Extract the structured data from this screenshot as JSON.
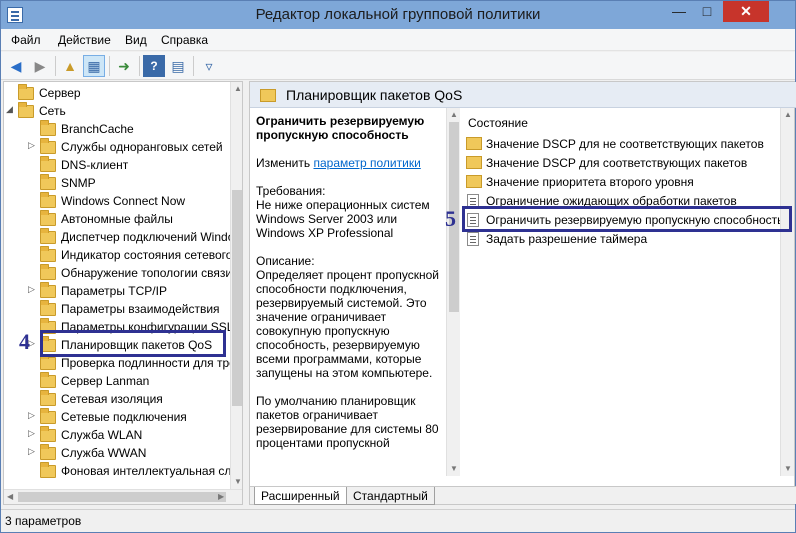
{
  "window": {
    "title": "Редактор локальной групповой политики"
  },
  "menu": [
    "Файл",
    "Действие",
    "Вид",
    "Справка"
  ],
  "tree": {
    "items": [
      {
        "label": "Сервер",
        "expander": ""
      },
      {
        "label": "Сеть",
        "expander": "◢"
      },
      {
        "label": "BranchCache",
        "expander": ""
      },
      {
        "label": "Службы одноранговых сетей",
        "expander": "▷"
      },
      {
        "label": "DNS-клиент",
        "expander": ""
      },
      {
        "label": "SNMP",
        "expander": ""
      },
      {
        "label": "Windows Connect Now",
        "expander": ""
      },
      {
        "label": "Автономные файлы",
        "expander": ""
      },
      {
        "label": "Диспетчер подключений Windows",
        "expander": ""
      },
      {
        "label": "Индикатор состояния сетевого подключения",
        "expander": ""
      },
      {
        "label": "Обнаружение топологии связи",
        "expander": ""
      },
      {
        "label": "Параметры TCP/IP",
        "expander": "▷"
      },
      {
        "label": "Параметры взаимодействия",
        "expander": ""
      },
      {
        "label": "Параметры конфигурации SSL",
        "expander": ""
      },
      {
        "label": "Планировщик пакетов QoS",
        "expander": "▷"
      },
      {
        "label": "Проверка подлинности для требования",
        "expander": ""
      },
      {
        "label": "Сервер Lanman",
        "expander": ""
      },
      {
        "label": "Сетевая изоляция",
        "expander": ""
      },
      {
        "label": "Сетевые подключения",
        "expander": "▷"
      },
      {
        "label": "Служба WLAN",
        "expander": "▷"
      },
      {
        "label": "Служба WWAN",
        "expander": "▷"
      },
      {
        "label": "Фоновая интеллектуальная служба",
        "expander": ""
      }
    ]
  },
  "right": {
    "header": "Планировщик пакетов QoS",
    "desc": {
      "title": "Ограничить резервируемую пропускную способность",
      "edit_prefix": "Изменить ",
      "edit_link": "параметр политики",
      "req_label": "Требования:",
      "req_text": "Не ниже операционных систем Windows Server 2003 или Windows XP Professional",
      "desc_label": "Описание:",
      "desc_text": "Определяет процент пропускной способности подключения, резервируемый системой. Это значение ограничивает совокупную пропускную способность, резервируемую всеми программами, которые запущены на этом компьютере.",
      "default_text": "По умолчанию планировщик пакетов ограничивает резервирование для системы 80 процентами пропускной"
    },
    "column_header": "Состояние",
    "items": [
      {
        "label": "Значение DSCP для не соответствующих пакетов",
        "kind": "folder"
      },
      {
        "label": "Значение DSCP для соответствующих пакетов",
        "kind": "folder"
      },
      {
        "label": "Значение приоритета второго уровня",
        "kind": "folder"
      },
      {
        "label": "Ограничение ожидающих обработки пакетов",
        "kind": "setting"
      },
      {
        "label": "Ограничить резервируемую пропускную способность",
        "kind": "setting"
      },
      {
        "label": "Задать разрешение таймера",
        "kind": "setting"
      }
    ],
    "tabs": [
      "Расширенный",
      "Стандартный"
    ]
  },
  "status": "3 параметров",
  "annotations": {
    "tree": "4",
    "list": "5"
  },
  "colors": {
    "highlight": "#2e3192",
    "titlebar": "#7ea7d8"
  }
}
